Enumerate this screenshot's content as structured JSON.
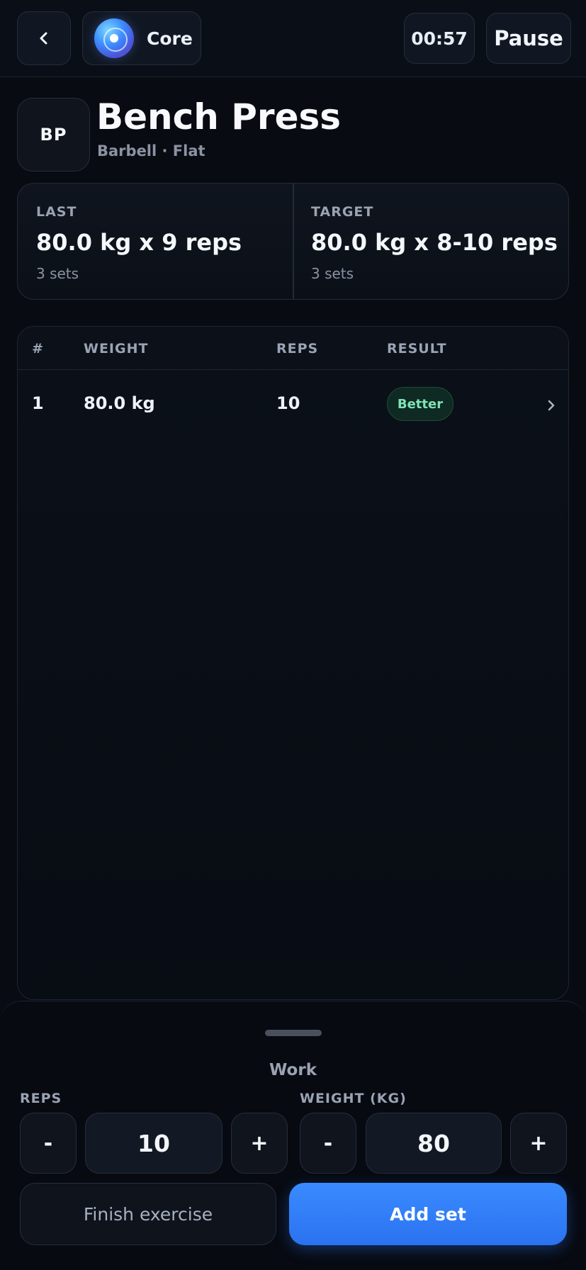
{
  "header": {
    "back_icon": "chevron-left-icon",
    "context_label": "Core",
    "context_icon": "orb-icon",
    "timer": "00:57",
    "pause_label": "Pause"
  },
  "exercise": {
    "badge": "BP",
    "title": "Bench Press",
    "subtitle": "Barbell · Flat"
  },
  "stats": {
    "last": {
      "label": "LAST",
      "value": "80.0 kg x 9 reps",
      "note": "3 sets"
    },
    "target": {
      "label": "TARGET",
      "value": "80.0 kg x 8-10 reps",
      "note": "3 sets"
    }
  },
  "sets_table": {
    "columns": [
      "#",
      "WEIGHT",
      "REPS",
      "RESULT"
    ],
    "rows": [
      {
        "index": "1",
        "weight": "80.0 kg",
        "reps": "10",
        "result": "Better"
      }
    ]
  },
  "sheet": {
    "title": "Work",
    "reps": {
      "label": "REPS",
      "minus": "-",
      "value": "10",
      "plus": "+"
    },
    "weight": {
      "label": "WEIGHT (KG)",
      "minus": "-",
      "value": "80",
      "plus": "+"
    },
    "finish_label": "Finish exercise",
    "add_label": "Add set"
  },
  "colors": {
    "background": "#080b12",
    "accent": "#3a8bff",
    "success": "#7fe3b7"
  }
}
